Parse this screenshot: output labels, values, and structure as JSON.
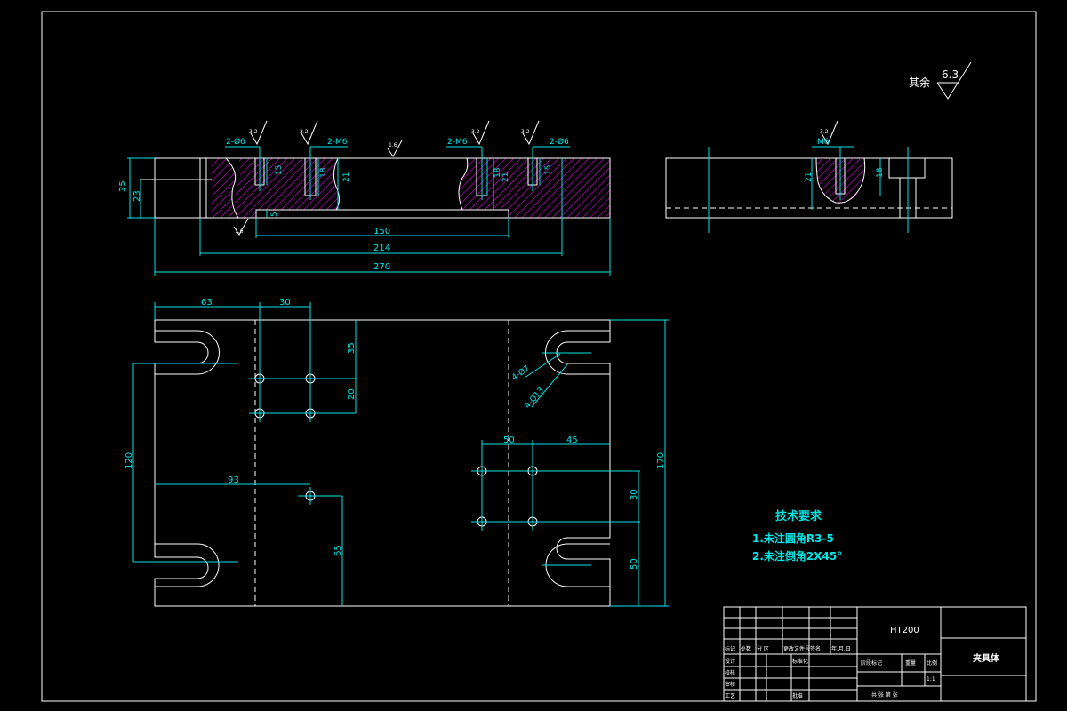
{
  "surface_note": {
    "prefix": "其余",
    "value": "6.3"
  },
  "front_view": {
    "callouts": [
      "2-Ø6",
      "2-M6",
      "2-M6",
      "2-Ø6"
    ],
    "roughness_top": "1.6",
    "roughness_small": "3.2",
    "roughness_bottom": "1.6",
    "dims": {
      "h35": "35",
      "h23": "23",
      "d15a": "15",
      "d18a": "18",
      "d21a": "21",
      "d21b": "21",
      "d18b": "18",
      "d15b": "15",
      "d5": "5",
      "w150": "150",
      "w214": "214",
      "w270": "270"
    }
  },
  "side_view": {
    "callout": "M6",
    "d21": "21",
    "d18": "18",
    "roughness": "3.2"
  },
  "top_view": {
    "dims": {
      "d63": "63",
      "d30": "30",
      "d35": "35",
      "d20": "20",
      "d120": "120",
      "d93": "93",
      "d65": "65",
      "d50a": "50",
      "d45": "45",
      "d30b": "30",
      "d50b": "50",
      "d170": "170"
    },
    "hole_notes": [
      "4-Ø7",
      "4-Ø13"
    ]
  },
  "tech_req": {
    "title": "技术要求",
    "items": [
      "1.未注圆角R3-5",
      "2.未注倒角2X45°"
    ]
  },
  "title_block": {
    "material": "HT200",
    "part_name": "夹具体",
    "labels": {
      "mark": "标记",
      "count": "处数",
      "zone": "分 区",
      "doc": "更改文件号",
      "sign": "签名",
      "date": "年.月.日",
      "design": "设计",
      "check": "校核",
      "review": "审核",
      "process": "工艺",
      "standard": "标准化",
      "approve": "批准",
      "stage": "阶段标记",
      "weight": "重量",
      "scale": "比例",
      "scale_value": "1:1",
      "sheets": "共  张  第  张"
    }
  }
}
